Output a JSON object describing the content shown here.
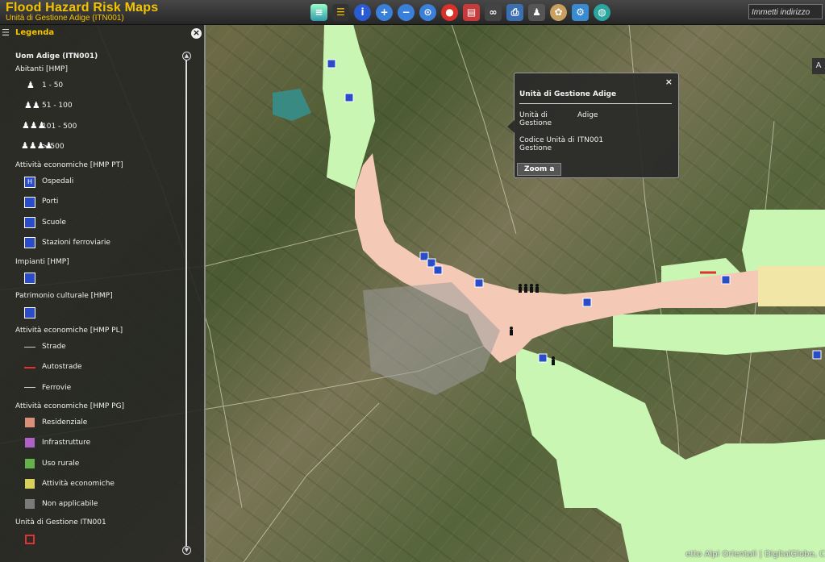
{
  "header": {
    "title": "Flood Hazard Risk Maps",
    "subtitle": "Unità di Gestione Adige (ITN001)",
    "address_placeholder": "Immetti indirizzo"
  },
  "toolbar": {
    "icons": [
      "layers-icon",
      "list-icon",
      "info-icon",
      "zoom-in-icon",
      "zoom-out-icon",
      "zoom-extent-icon",
      "stop-icon",
      "book-icon",
      "binoculars-icon",
      "print-icon",
      "people-icon",
      "palette-icon",
      "settings-icon",
      "globe-icon"
    ]
  },
  "legend": {
    "title": "Legenda",
    "close_label": "×",
    "section_title": "Uom Adige (ITN001)",
    "abitanti": {
      "title": "Abitanti [HMP]",
      "items": [
        "1 - 50",
        "51 - 100",
        "101 - 500",
        "> 500"
      ]
    },
    "attivita_pt": {
      "title": "Attività economiche [HMP PT]",
      "items": [
        "Ospedali",
        "Porti",
        "Scuole",
        "Stazioni ferroviarie"
      ]
    },
    "impianti": {
      "title": "Impianti [HMP]"
    },
    "patrimonio": {
      "title": "Patrimonio culturale [HMP]"
    },
    "attivita_pl": {
      "title": "Attività economiche [HMP PL]",
      "items": [
        "Strade",
        "Autostrade",
        "Ferrovie"
      ]
    },
    "attivita_pg": {
      "title": "Attività economiche [HMP PG]",
      "items": [
        "Residenziale",
        "Infrastrutture",
        "Uso rurale",
        "Attività economiche",
        "Non applicabile"
      ],
      "colors": [
        "#d8907a",
        "#b061c8",
        "#64b24a",
        "#d8d05a",
        "#7a7a7a"
      ]
    },
    "unita": {
      "title": "Unità di Gestione ITN001"
    }
  },
  "popup": {
    "title": "Unità di Gestione Adige",
    "close_label": "×",
    "rows": [
      {
        "label": "Unità di Gestione",
        "value": "Adige"
      },
      {
        "label": "Codice Unità di Gestione",
        "value": "ITN001"
      }
    ],
    "zoom_button": "Zoom a"
  },
  "map": {
    "attribution": "etto Alpi Orientali | DigitalGlobe, C",
    "side_button": "A",
    "colors": {
      "residential": "#f4c9b6",
      "rural": "#c9f6b2",
      "economic": "#f2e6a6"
    }
  }
}
